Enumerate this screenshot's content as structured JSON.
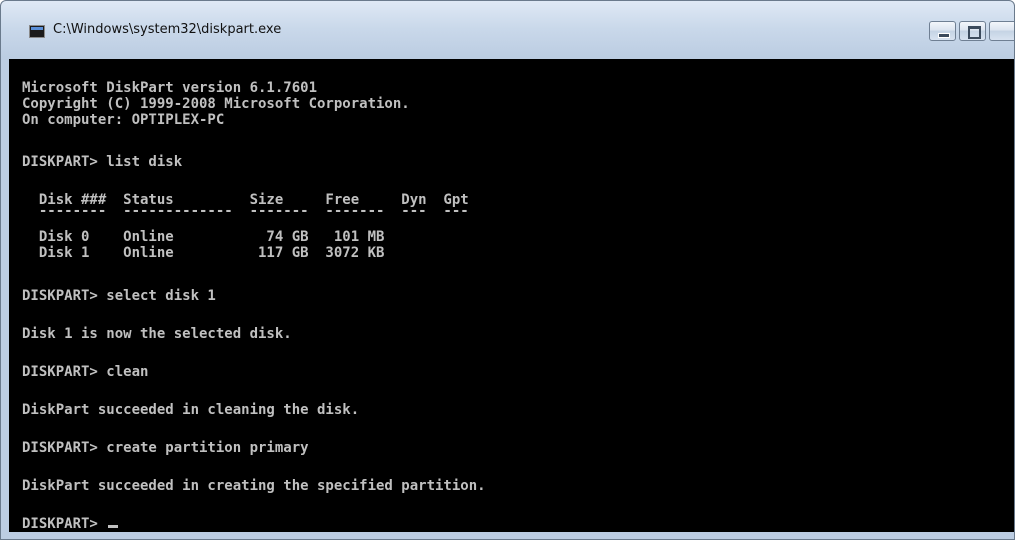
{
  "window": {
    "title": "C:\\Windows\\system32\\diskpart.exe",
    "icon": "console-app-icon"
  },
  "controls": {
    "minimize": "minimize-icon",
    "maximize": "maximize-icon"
  },
  "console": {
    "background": "#000000",
    "foreground": "#c0c0c0",
    "lines": [
      "Microsoft DiskPart version 6.1.7601",
      "Copyright (C) 1999-2008 Microsoft Corporation.",
      "On computer: OPTIPLEX-PC",
      "DISKPART> list disk",
      "  Disk ###  Status         Size     Free     Dyn  Gpt",
      "  --------  -------------  -------  -------  ---  ---",
      "  Disk 0    Online           74 GB   101 MB",
      "  Disk 1    Online          117 GB  3072 KB",
      "DISKPART> select disk 1",
      "Disk 1 is now the selected disk.",
      "DISKPART> clean",
      "DiskPart succeeded in cleaning the disk.",
      "DISKPART> create partition primary",
      "DiskPart succeeded in creating the specified partition.",
      "DISKPART> "
    ]
  }
}
